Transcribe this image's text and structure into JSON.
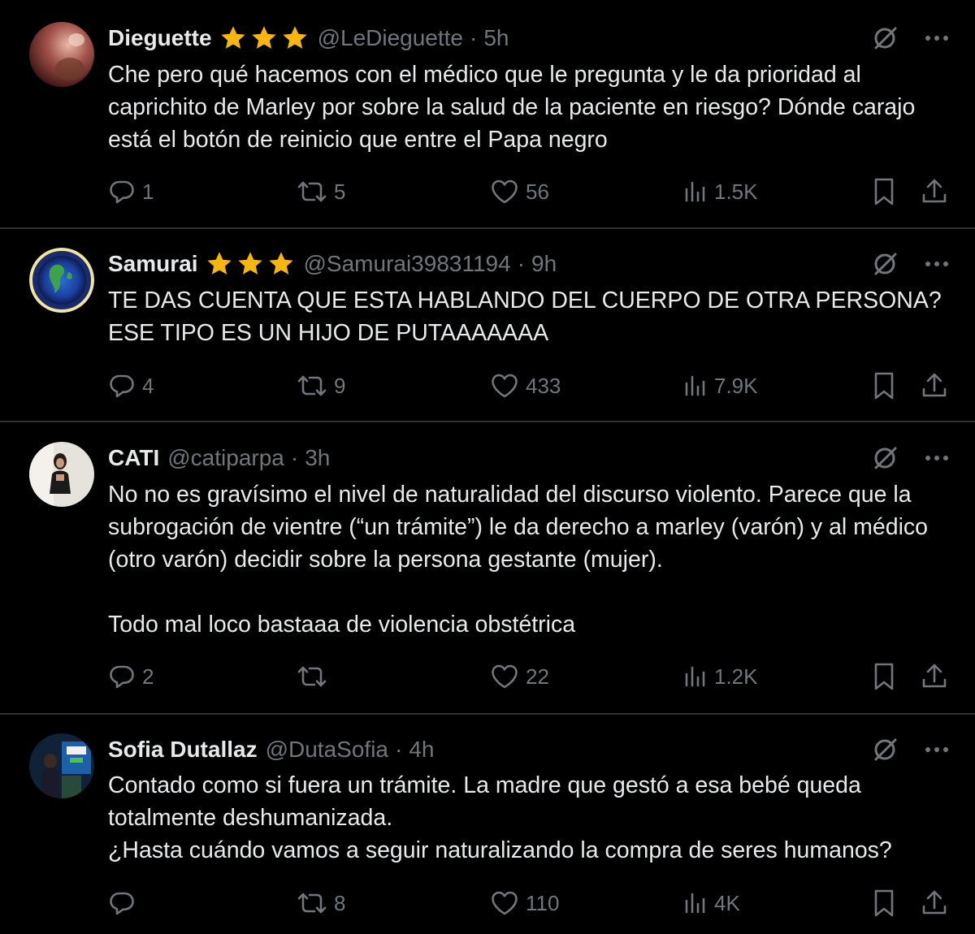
{
  "colors": {
    "background": "#000000",
    "text_primary": "#e7e9ea",
    "text_secondary": "#71767b",
    "divider": "#2f3336",
    "star": "#f5b60f"
  },
  "tweets": [
    {
      "name": "Dieguette",
      "stars": 3,
      "handle": "@LeDieguette",
      "time": "5h",
      "text": "Che pero qué hacemos con el médico que le pregunta y le da prioridad al caprichito de Marley por sobre la salud de la paciente en riesgo? Dónde carajo está el botón de reinicio que entre el Papa negro",
      "replies": "1",
      "reposts": "5",
      "likes": "56",
      "views": "1.5K",
      "avatar_icon": "profile-photo"
    },
    {
      "name": "Samurai",
      "stars": 3,
      "handle": "@Samurai39831194",
      "time": "9h",
      "text": "TE DAS CUENTA QUE ESTA HABLANDO DEL CUERPO DE OTRA PERSONA? ESE TIPO ES UN HIJO DE PUTAAAAAAA",
      "replies": "4",
      "reposts": "9",
      "likes": "433",
      "views": "7.9K",
      "avatar_icon": "globe-emblem"
    },
    {
      "name": "CATI",
      "stars": 0,
      "handle": "@catiparpa",
      "time": "3h",
      "text": "No no es gravísimo el nivel de naturalidad del discurso violento. Parece que la subrogación de vientre (“un trámite”) le da derecho a marley (varón) y al médico (otro varón) decidir sobre la persona gestante (mujer).\n\nTodo mal loco bastaaa de violencia obstétrica",
      "replies": "2",
      "reposts": "",
      "likes": "22",
      "views": "1.2K",
      "avatar_icon": "profile-photo"
    },
    {
      "name": "Sofia Dutallaz",
      "stars": 0,
      "handle": "@DutaSofia",
      "time": "4h",
      "text": "Contado como si fuera un trámite. La madre que gestó a esa bebé queda totalmente deshumanizada.\n¿Hasta cuándo vamos a seguir naturalizando la compra de seres humanos?",
      "replies": "",
      "reposts": "8",
      "likes": "110",
      "views": "4K",
      "avatar_icon": "profile-photo"
    }
  ],
  "header_separator": "·"
}
